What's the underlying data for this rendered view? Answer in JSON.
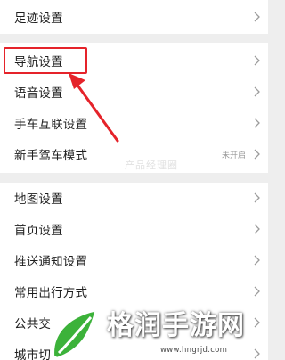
{
  "settings": {
    "items": [
      {
        "label": "足迹设置",
        "value": ""
      },
      {
        "label": "导航设置",
        "value": ""
      },
      {
        "label": "语音设置",
        "value": ""
      },
      {
        "label": "手车互联设置",
        "value": ""
      },
      {
        "label": "新手驾车模式",
        "value": "未开启"
      },
      {
        "label": "地图设置",
        "value": ""
      },
      {
        "label": "首页设置",
        "value": ""
      },
      {
        "label": "推送通知设置",
        "value": ""
      },
      {
        "label": "常用出行方式",
        "value": ""
      },
      {
        "label": "公共交",
        "value": ""
      },
      {
        "label": "城市切",
        "value": ""
      }
    ]
  },
  "icons": {
    "chevron": "chevron-right-icon"
  },
  "annotation": {
    "highlight_color": "#e5232a",
    "highlighted_item": "导航设置"
  },
  "watermark": {
    "title": "格润手游网",
    "url": "www.hngrjd.com",
    "faint_text": "产品经理圈",
    "leaf_color": "#3cb23a"
  }
}
